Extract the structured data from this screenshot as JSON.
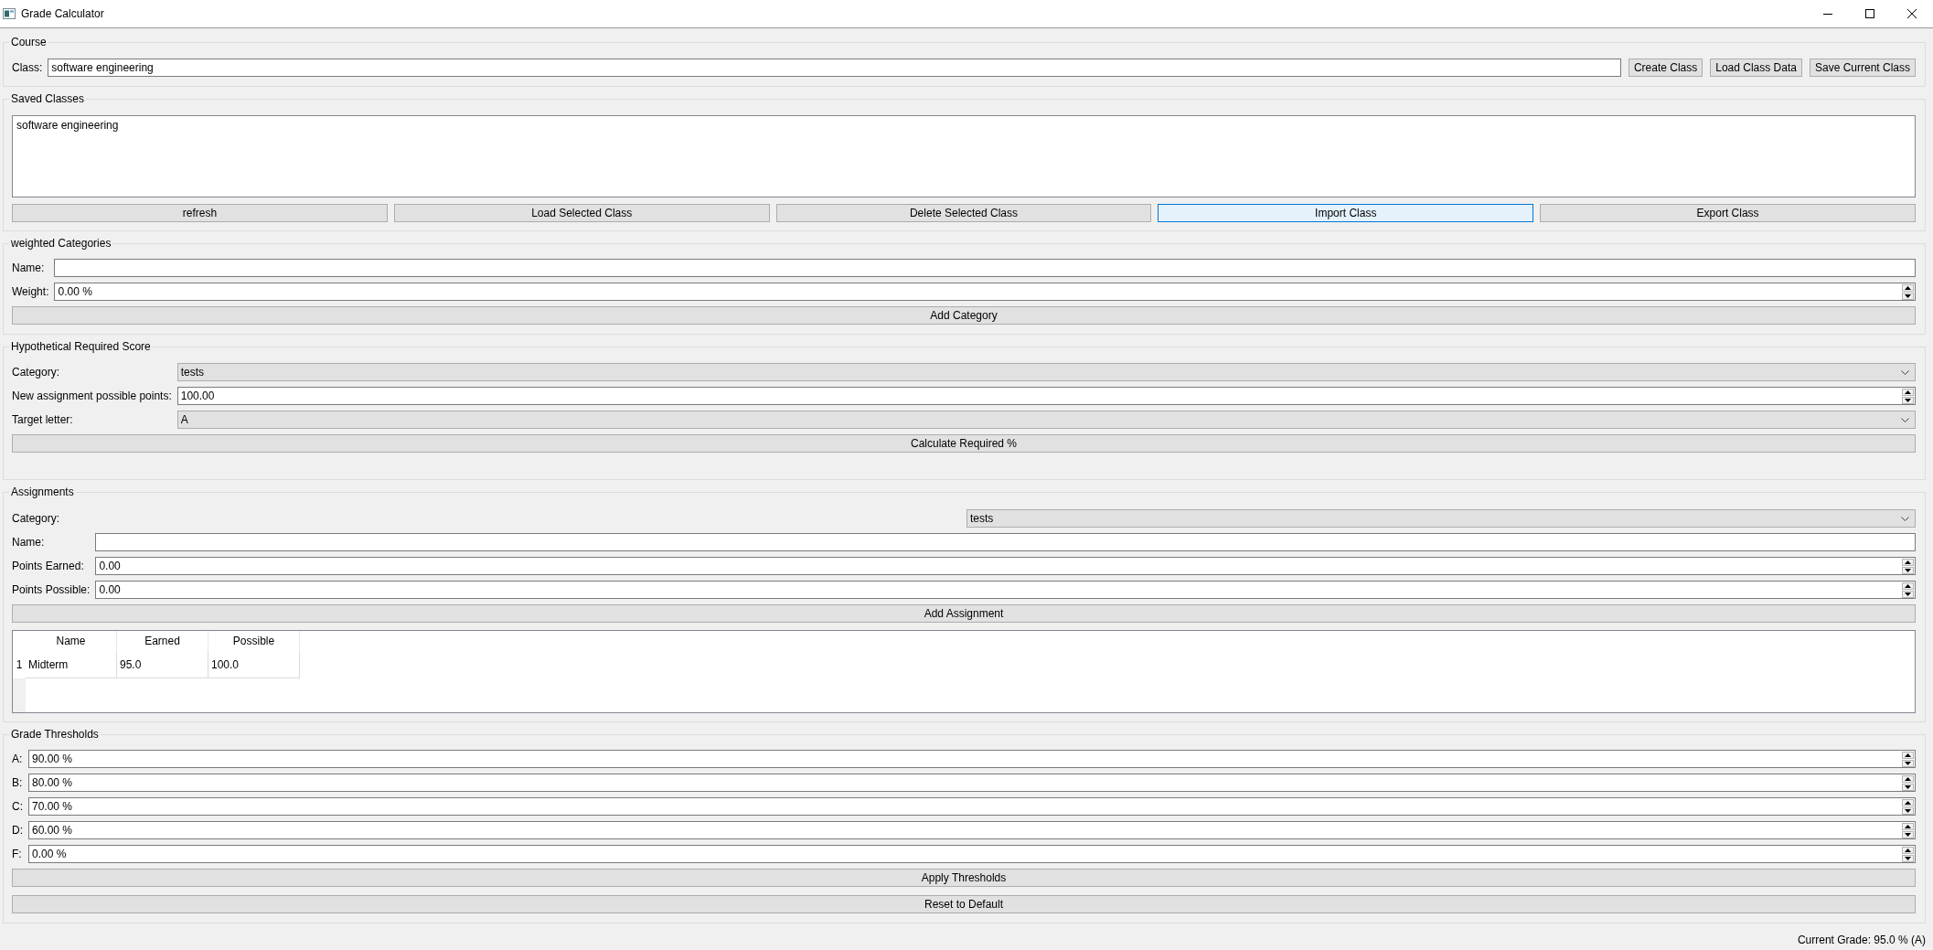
{
  "window": {
    "title": "Grade Calculator"
  },
  "course": {
    "title": "Course",
    "class_label": "Class:",
    "class_value": "software engineering",
    "buttons": [
      {
        "label": "Create Class"
      },
      {
        "label": "Load Class Data"
      },
      {
        "label": "Save Current Class"
      }
    ]
  },
  "saved_classes": {
    "title": "Saved Classes",
    "items": [
      {
        "label": "software engineering",
        "selected": false
      }
    ],
    "buttons": [
      {
        "label": "refresh",
        "hovered": false
      },
      {
        "label": "Load Selected Class",
        "hovered": false
      },
      {
        "label": "Delete Selected Class",
        "hovered": false
      },
      {
        "label": "Import Class",
        "hovered": true
      },
      {
        "label": "Export Class",
        "hovered": false
      }
    ]
  },
  "weighted_categories": {
    "title": "weighted Categories",
    "fields": [
      {
        "kind": "text",
        "label": "Name:"
      },
      {
        "kind": "spin",
        "label": "Weight:",
        "value": "0.00 %"
      }
    ],
    "buttons": [
      {
        "label": "Add Category"
      }
    ]
  },
  "hypothetical_required_score": {
    "title": "Hypothetical Required Score",
    "fields": [
      {
        "kind": "combo",
        "label": "Category:",
        "value": "tests"
      },
      {
        "kind": "spin",
        "label": "New assignment possible points:",
        "value": "100.00"
      },
      {
        "kind": "combo",
        "label": "Target letter:",
        "value": "A"
      }
    ],
    "buttons": [
      {
        "label": "Calculate Required %"
      }
    ]
  },
  "assignments": {
    "title": "Assignments",
    "category": {
      "label": "Category:",
      "value": "tests"
    },
    "fields": [
      {
        "kind": "text",
        "label": "Name:"
      },
      {
        "kind": "spin",
        "label": "Points Earned:",
        "value": "0.00"
      },
      {
        "kind": "spin",
        "label": "Points Possible:",
        "value": "0.00"
      }
    ],
    "buttons": [
      {
        "label": "Add Assignment"
      }
    ],
    "table": {
      "columns": [
        "Name",
        "Earned",
        "Possible"
      ],
      "rows": [
        {
          "number": "1",
          "cells": [
            "Midterm",
            "95.0",
            "100.0"
          ]
        }
      ]
    }
  },
  "grade_thresholds": {
    "title": "Grade Thresholds",
    "fields": [
      {
        "kind": "spin",
        "label": "A:",
        "value": "90.00 %"
      },
      {
        "kind": "spin",
        "label": "B:",
        "value": "80.00 %"
      },
      {
        "kind": "spin",
        "label": "C:",
        "value": "70.00 %"
      },
      {
        "kind": "spin",
        "label": "D:",
        "value": "60.00 %"
      },
      {
        "kind": "spin",
        "label": "F:",
        "value": "0.00 %"
      }
    ],
    "buttons": [
      {
        "label": "Apply Thresholds"
      },
      {
        "label": "Reset to Default"
      }
    ]
  },
  "status_bar": {
    "current_grade": "Current Grade: 95.0 % (A)"
  }
}
